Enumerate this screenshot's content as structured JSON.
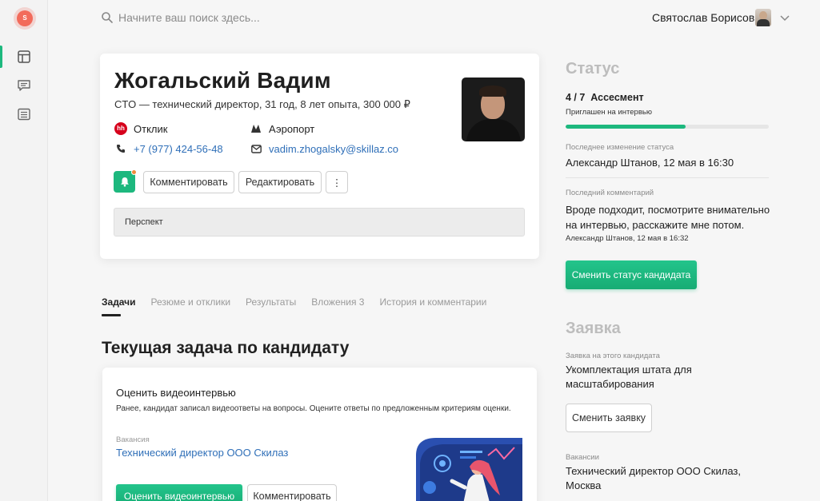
{
  "app": {
    "logo_letter": "S"
  },
  "search": {
    "placeholder": "Начните ваш поиск здесь..."
  },
  "user": {
    "name": "Святослав Борисов"
  },
  "candidate": {
    "name": "Жогальский Вадим",
    "summary": "CTO — технический директор, 31 год, 8 лет опыта, 300 000 ₽",
    "source": "Отклик",
    "metro": "Аэропорт",
    "phone": "+7 (977) 424-56-48",
    "email": "vadim.zhogalsky@skillaz.co",
    "comment_button": "Комментировать",
    "edit_button": "Редактировать",
    "more_button": "⋮",
    "pipeline_label": "Перспект"
  },
  "tabs": [
    {
      "label": "Задачи",
      "active": true
    },
    {
      "label": "Резюме и отклики"
    },
    {
      "label": "Результаты"
    },
    {
      "label": "Вложения 3"
    },
    {
      "label": "История и комментарии"
    }
  ],
  "current_task": {
    "section_title": "Текущая задача по кандидату",
    "title": "Оценить видеоинтервью",
    "description": "Ранее, кандидат записал видеоответы на вопросы. Оцените ответы по предложенным критериям оценки.",
    "vacancy_label": "Вакансия",
    "vacancy": "Технический директор ООО Скилаз",
    "primary_button": "Оценить видеоинтервью",
    "secondary_button": "Комментировать"
  },
  "status": {
    "heading": "Статус",
    "step": "4 / 7",
    "stage": "Ассесмент",
    "substage": "Приглашен на интервью",
    "progress": 0.59,
    "last_change_label": "Последнее изменение статуса",
    "last_change": "Александр Штанов, 12 мая в 16:30",
    "last_comment_label": "Последний комментарий",
    "last_comment": "Вроде подходит, посмотрите внимательно на интервью, расскажите мне потом.",
    "last_comment_meta": "Александр Штанов, 12 мая в 16:32",
    "change_status_button": "Сменить статус кандидата"
  },
  "request": {
    "heading": "Заявка",
    "label": "Заявка на этого кандидата",
    "value": "Укомплектация штата для масштабирования",
    "change_button": "Сменить заявку",
    "vacancy_label": "Вакансии",
    "vacancy": "Технический директор ООО Скилаз, Москва"
  },
  "colors": {
    "accent": "#1db87e",
    "link": "#2f6fb8",
    "logo": "#f26b5b",
    "hh": "#d6001c"
  },
  "icons": [
    "search-icon",
    "layout-icon",
    "chat-icon",
    "list-icon",
    "chevron-down-icon",
    "hh-icon",
    "metro-icon",
    "phone-icon",
    "mail-icon",
    "bell-icon"
  ]
}
